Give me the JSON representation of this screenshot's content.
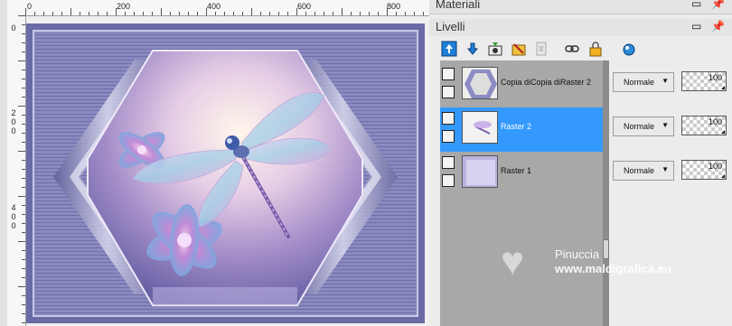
{
  "ruler": {
    "h_labels": [
      "0",
      "200",
      "400",
      "600",
      "800"
    ],
    "v_labels": [
      "0",
      "2",
      "0",
      "0",
      "4",
      "0",
      "0"
    ]
  },
  "panels": {
    "materials_title": "Materiali",
    "layers_title": "Livelli"
  },
  "toolbar_icons": [
    "new-raster-layer-icon",
    "new-vector-layer-icon",
    "new-mask-layer-icon",
    "new-adjustment-layer-icon",
    "delete-layer-icon",
    "link-layer-icon",
    "lock-layer-icon",
    "palette-icon"
  ],
  "layers": [
    {
      "name": "Copia diCopia diRaster 2",
      "blend": "Normale",
      "opacity": "100",
      "selected": false
    },
    {
      "name": "Raster 2",
      "blend": "Normale",
      "opacity": "100",
      "selected": true
    },
    {
      "name": "Raster 1",
      "blend": "Normale",
      "opacity": "100",
      "selected": false
    }
  ],
  "watermark": {
    "name": "Pinuccia",
    "url": "www.maldigrafica.eu"
  },
  "colors": {
    "selected_row": "#3399ff",
    "artwork_frame": "#7b7bb0"
  }
}
